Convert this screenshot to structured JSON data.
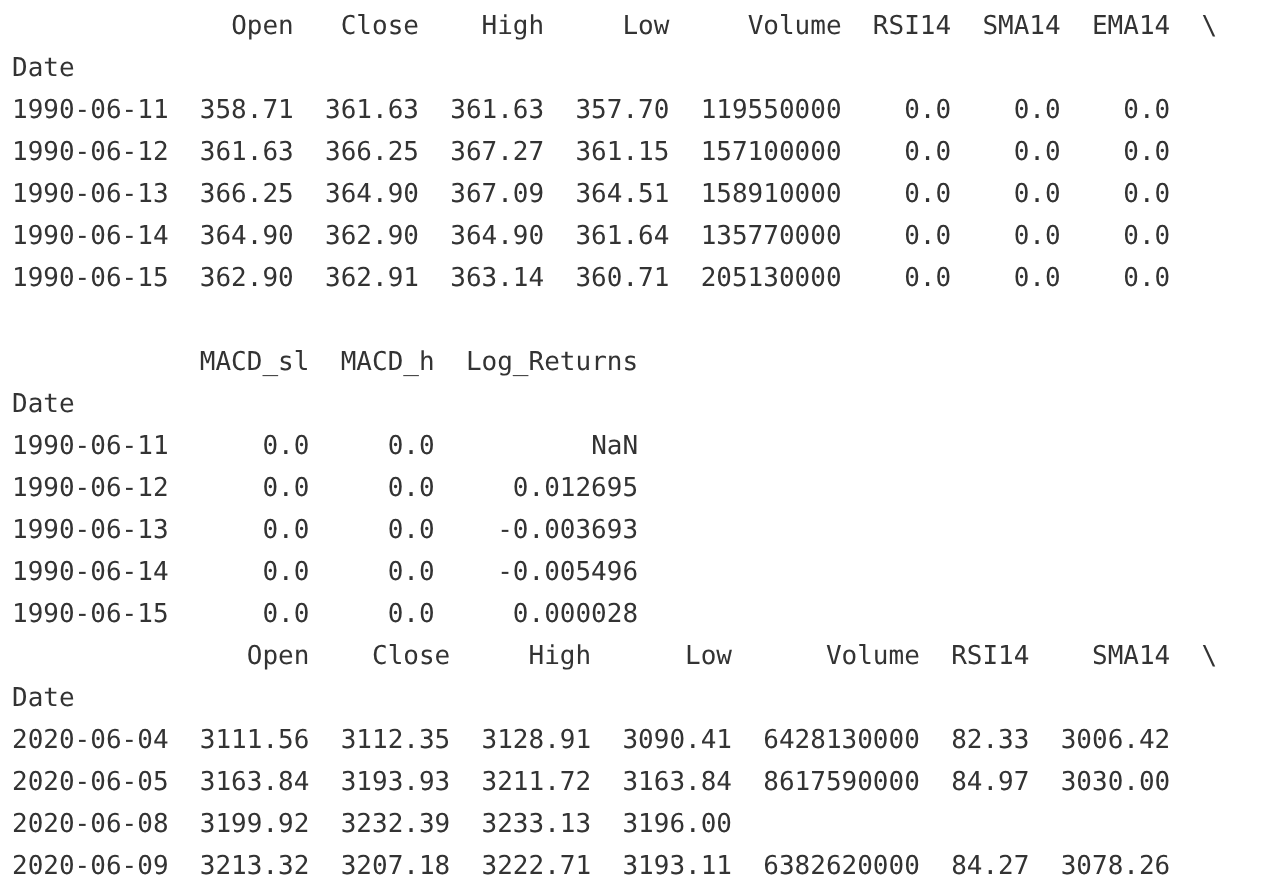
{
  "tables": [
    {
      "columns": [
        "Open",
        "Close",
        "High",
        "Low",
        "Volume",
        "RSI14",
        "SMA14",
        "EMA14"
      ],
      "continuation": "\\",
      "index_name": "Date",
      "rows": [
        {
          "date": "1990-06-11",
          "values": [
            "358.71",
            "361.63",
            "361.63",
            "357.70",
            "119550000",
            "0.0",
            "0.0",
            "0.0"
          ]
        },
        {
          "date": "1990-06-12",
          "values": [
            "361.63",
            "366.25",
            "367.27",
            "361.15",
            "157100000",
            "0.0",
            "0.0",
            "0.0"
          ]
        },
        {
          "date": "1990-06-13",
          "values": [
            "366.25",
            "364.90",
            "367.09",
            "364.51",
            "158910000",
            "0.0",
            "0.0",
            "0.0"
          ]
        },
        {
          "date": "1990-06-14",
          "values": [
            "364.90",
            "362.90",
            "364.90",
            "361.64",
            "135770000",
            "0.0",
            "0.0",
            "0.0"
          ]
        },
        {
          "date": "1990-06-15",
          "values": [
            "362.90",
            "362.91",
            "363.14",
            "360.71",
            "205130000",
            "0.0",
            "0.0",
            "0.0"
          ]
        }
      ],
      "blank_after": true
    },
    {
      "columns": [
        "MACD_sl",
        "MACD_h",
        "Log_Returns"
      ],
      "index_name": "Date",
      "rows": [
        {
          "date": "1990-06-11",
          "values": [
            "0.0",
            "0.0",
            "NaN"
          ]
        },
        {
          "date": "1990-06-12",
          "values": [
            "0.0",
            "0.0",
            "0.012695"
          ]
        },
        {
          "date": "1990-06-13",
          "values": [
            "0.0",
            "0.0",
            "-0.003693"
          ]
        },
        {
          "date": "1990-06-14",
          "values": [
            "0.0",
            "0.0",
            "-0.005496"
          ]
        },
        {
          "date": "1990-06-15",
          "values": [
            "0.0",
            "0.0",
            "0.000028"
          ]
        }
      ],
      "blank_after": false
    },
    {
      "columns": [
        "Open",
        "Close",
        "High",
        "Low",
        "Volume",
        "RSI14",
        "SMA14"
      ],
      "continuation": "\\",
      "index_name": "Date",
      "rows": [
        {
          "date": "2020-06-04",
          "values": [
            "3111.56",
            "3112.35",
            "3128.91",
            "3090.41",
            "6428130000",
            "82.33",
            "3006.42"
          ]
        },
        {
          "date": "2020-06-05",
          "values": [
            "3163.84",
            "3193.93",
            "3211.72",
            "3163.84",
            "8617590000",
            "84.97",
            "3030.00"
          ]
        },
        {
          "date": "2020-06-08",
          "values": [
            "3199.92",
            "3232.39",
            "3233.13",
            "3196.00"
          ]
        },
        {
          "date": "2020-06-09",
          "values": [
            "3213.32",
            "3207.18",
            "3222.71",
            "3193.11",
            "6382620000",
            "84.27",
            "3078.26"
          ]
        }
      ]
    }
  ]
}
